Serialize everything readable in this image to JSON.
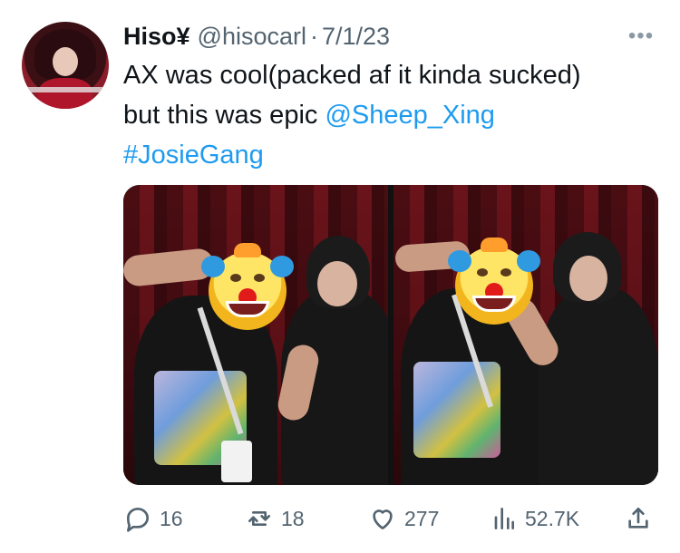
{
  "tweet": {
    "author": {
      "display_name": "Hiso¥",
      "handle": "@hisocarl",
      "separator": "·",
      "date": "7/1/23"
    },
    "text": {
      "line_1": "AX was cool(packed af it kinda sucked)",
      "line_2_prefix": "but this was epic ",
      "mention": "@Sheep_Xing",
      "hashtag": "#JosieGang"
    },
    "actions": {
      "replies": "16",
      "reposts": "18",
      "likes": "277",
      "views": "52.7K"
    },
    "icons": {
      "more": "more-icon",
      "reply": "reply-icon",
      "repost": "repost-icon",
      "like": "like-icon",
      "views": "views-icon",
      "share": "share-icon"
    },
    "colors": {
      "link": "#1d9bf0",
      "text": "#0f1419",
      "muted": "#536471"
    }
  }
}
